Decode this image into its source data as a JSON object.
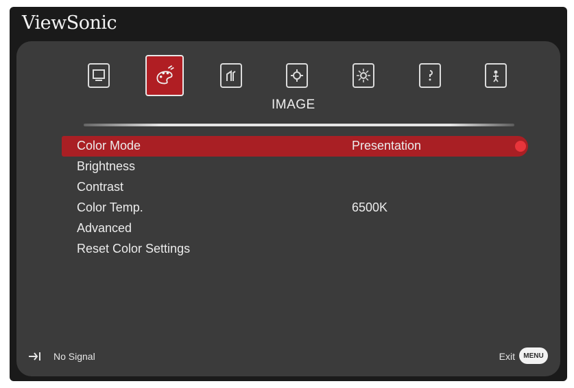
{
  "brand": {
    "name": "ViewSonic"
  },
  "tabs": [
    {
      "icon": "display-icon",
      "active": false
    },
    {
      "icon": "image-palette-icon",
      "active": true
    },
    {
      "icon": "power-management-icon",
      "active": false
    },
    {
      "icon": "basic-settings-icon",
      "active": false
    },
    {
      "icon": "advanced-settings-icon",
      "active": false
    },
    {
      "icon": "information-icon",
      "active": false
    },
    {
      "icon": "user-icon",
      "active": false
    }
  ],
  "section": {
    "title": "IMAGE"
  },
  "menu": {
    "items": [
      {
        "label": "Color Mode",
        "value": "Presentation"
      },
      {
        "label": "Brightness",
        "value": ""
      },
      {
        "label": "Contrast",
        "value": ""
      },
      {
        "label": "Color Temp.",
        "value": "6500K"
      },
      {
        "label": "Advanced",
        "value": ""
      },
      {
        "label": "Reset Color Settings",
        "value": ""
      }
    ],
    "selected_index": 0
  },
  "footer": {
    "signal_text": "No Signal",
    "exit_text": "Exit",
    "menu_key_label": "MENU"
  },
  "colors": {
    "accent": "#b01e23",
    "panel": "#3b3b3b",
    "frame": "#1a1a1a"
  }
}
